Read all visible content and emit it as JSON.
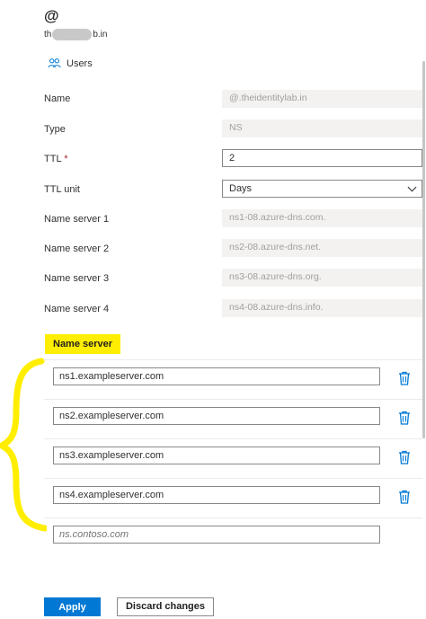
{
  "header": {
    "title": "@",
    "subtitle_prefix": "th",
    "subtitle_suffix": "b.in"
  },
  "tab": {
    "label": "Users",
    "icon": "users-icon"
  },
  "form": {
    "name_label": "Name",
    "name_value": "@.theidentitylab.in",
    "type_label": "Type",
    "type_value": "NS",
    "ttl_label": "TTL",
    "ttl_required": "*",
    "ttl_value": "2",
    "ttl_unit_label": "TTL unit",
    "ttl_unit_value": "Days",
    "ns_labels": [
      "Name server 1",
      "Name server 2",
      "Name server 3",
      "Name server 4"
    ],
    "ns_values": [
      "ns1-08.azure-dns.com.",
      "ns2-08.azure-dns.net.",
      "ns3-08.azure-dns.org.",
      "ns4-08.azure-dns.info."
    ]
  },
  "name_server_section": {
    "header": "Name server",
    "entries": [
      "ns1.exampleserver.com",
      "ns2.exampleserver.com",
      "ns3.exampleserver.com",
      "ns4.exampleserver.com"
    ],
    "new_placeholder": "ns.contoso.com"
  },
  "actions": {
    "apply_label": "Apply",
    "discard_label": "Discard changes"
  },
  "colors": {
    "accent": "#0078d4",
    "highlight": "#ffee00",
    "required": "#a4262c"
  }
}
